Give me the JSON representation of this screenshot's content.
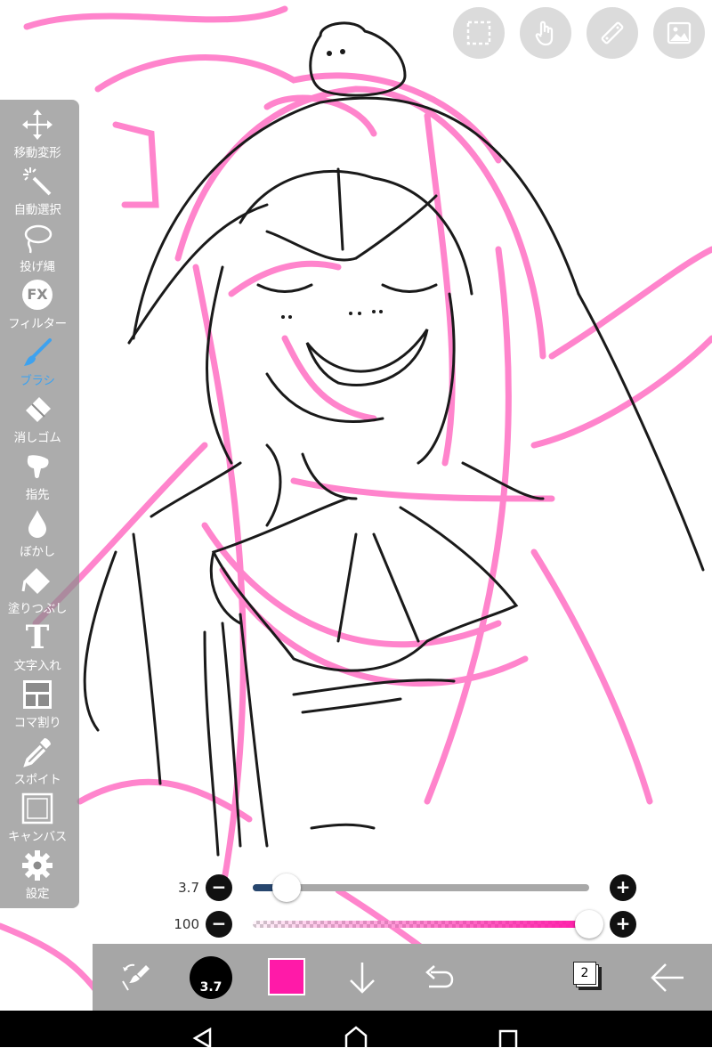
{
  "app": {
    "accent": "#3ea2ef",
    "sketch_color": "#ff57b8"
  },
  "top_buttons": [
    {
      "name": "selection-icon"
    },
    {
      "name": "hand-icon"
    },
    {
      "name": "ruler-icon"
    },
    {
      "name": "image-icon"
    }
  ],
  "toolbar": {
    "items": [
      {
        "label": "移動変形",
        "icon": "move-icon"
      },
      {
        "label": "自動選択",
        "icon": "magic-wand-icon"
      },
      {
        "label": "投げ縄",
        "icon": "lasso-icon"
      },
      {
        "label": "フィルター",
        "icon": "fx-icon",
        "glyph": "FX"
      },
      {
        "label": "ブラシ",
        "icon": "brush-icon",
        "active": true
      },
      {
        "label": "消しゴム",
        "icon": "eraser-icon"
      },
      {
        "label": "指先",
        "icon": "finger-icon"
      },
      {
        "label": "ぼかし",
        "icon": "blur-drop-icon"
      },
      {
        "label": "塗りつぶし",
        "icon": "bucket-icon"
      },
      {
        "label": "文字入れ",
        "icon": "text-icon",
        "glyph": "T"
      },
      {
        "label": "コマ割り",
        "icon": "frame-divide-icon"
      },
      {
        "label": "スポイト",
        "icon": "eyedropper-icon"
      },
      {
        "label": "キャンバス",
        "icon": "canvas-icon"
      },
      {
        "label": "設定",
        "icon": "gear-icon"
      }
    ]
  },
  "brush_size": {
    "value": "3.7",
    "level": 0.1
  },
  "opacity": {
    "value": "100",
    "level": 1.0,
    "color": "#ff1aa8"
  },
  "bottom_bar": {
    "brush_preview_label": "3.7",
    "current_color": "#ff1aa8",
    "layer_count": "2"
  }
}
